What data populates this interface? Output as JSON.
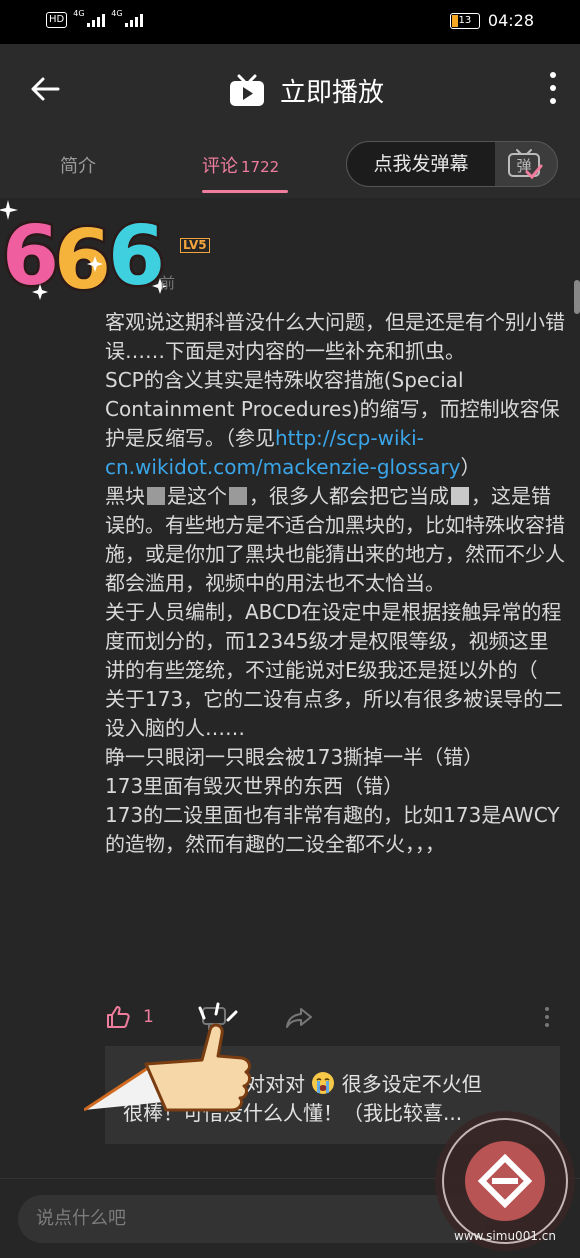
{
  "status_bar": {
    "hd": "HD",
    "network1": "4G",
    "network2": "4G",
    "battery": "13",
    "time": "04:28"
  },
  "header": {
    "title": "立即播放",
    "icons": [
      "back-arrow-icon",
      "tv-play-icon",
      "more-vertical-icon"
    ]
  },
  "tabs": {
    "intro": "简介",
    "comments": "评论",
    "comments_count": "1722",
    "danmaku_button": "点我发弹幕",
    "danmaku_icon_text": "弹"
  },
  "comment": {
    "sticker_text": "666",
    "level": "LV5",
    "time_fragment": "前",
    "paragraphs": {
      "p1": "客观说这期科普没什么大问题，但是还是有个别小错误……下面是对内容的一些补充和抓虫。",
      "p2_prefix": "SCP的含义其实是特殊收容措施(Special Containment Procedures)的缩写，而控制收容保护是反缩写。（参见",
      "p2_link": "http://scp-wiki-cn.wikidot.com/mackenzie-glossary",
      "p2_suffix": "）",
      "p3_a": "黑块",
      "p3_b": "是这个",
      "p3_c": "，很多人都会把它当成",
      "p3_d": "，这是错误的。有些地方是不适合加黑块的，比如特殊收容措施，或是你加了黑块也能猜出来的地方，然而不少人都会滥用，视频中的用法也不太恰当。",
      "p4": "关于人员编制，ABCD在设定中是根据接触异常的程度而划分的，而12345级才是权限等级，视频这里讲的有些笼统，不过能说对E级我还是挺以外的（",
      "p5": "关于173，它的二设有点多，所以有很多被误导的二设入脑的人……",
      "p6": "睁一只眼闭一只眼会被173撕掉一半（错）",
      "p7": "173里面有毁灭世界的东西（错）",
      "p8": "173的二设里面也有非常有趣的，比如173是AWCY的造物，然而有趣的二设全都不火，，，"
    },
    "like_count": "1"
  },
  "reply": {
    "line1_a": "对对对",
    "line1_b": "很多设定不火但",
    "line2": "很棒！可惜没什么人懂！（我比较喜..."
  },
  "input": {
    "placeholder": "说点什么吧"
  },
  "watermark": {
    "text": "www.simu001.cn"
  },
  "colors": {
    "accent": "#f07d9e",
    "link": "#3aa5e8",
    "background": "#262626",
    "header": "#2b2b2b"
  }
}
